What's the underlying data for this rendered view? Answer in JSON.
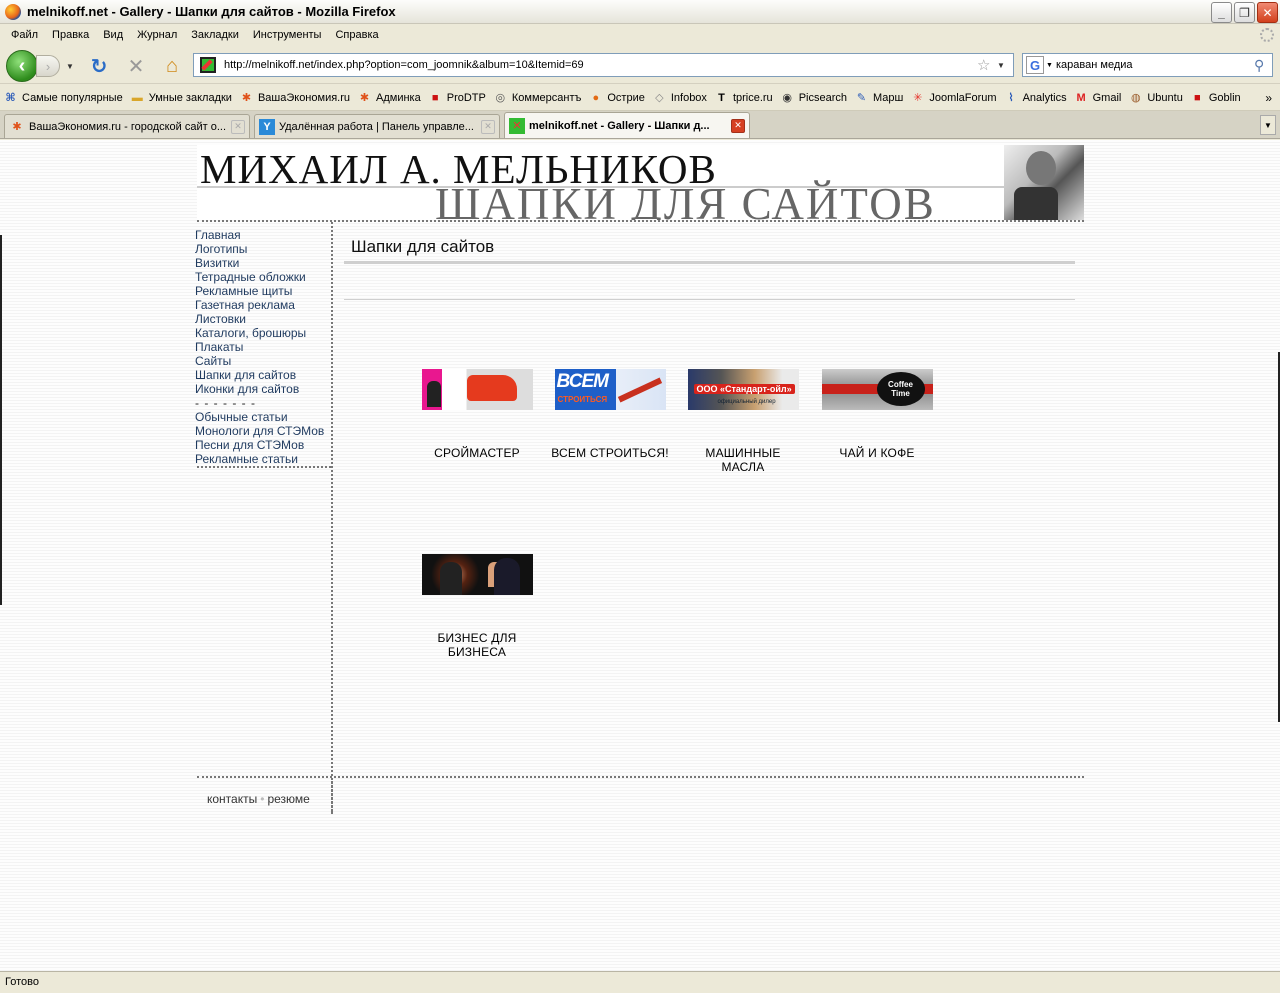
{
  "window": {
    "title": "melnikoff.net - Gallery - Шапки для сайтов - Mozilla Firefox"
  },
  "menu": [
    "Файл",
    "Правка",
    "Вид",
    "Журнал",
    "Закладки",
    "Инструменты",
    "Справка"
  ],
  "nav": {
    "url": "http://melnikoff.net/index.php?option=com_joomnik&album=10&Itemid=69",
    "search_value": "караван медиа"
  },
  "bookmarks": [
    {
      "label": "Самые популярные",
      "icon": "rss-icon"
    },
    {
      "label": "Умные закладки",
      "icon": "folder-icon"
    },
    {
      "label": "ВашаЭкономия.ru",
      "icon": "vashaekonomiya-icon"
    },
    {
      "label": "Админка",
      "icon": "vashaekonomiya-icon"
    },
    {
      "label": "ProDTP",
      "icon": "dtp-icon"
    },
    {
      "label": "Коммерсантъ",
      "icon": "kommersant-icon"
    },
    {
      "label": "Острие",
      "icon": "balloon-icon"
    },
    {
      "label": "Infobox",
      "icon": "box-icon"
    },
    {
      "label": "tprice.ru",
      "icon": "t-icon"
    },
    {
      "label": "Picsearch",
      "icon": "picsearch-icon"
    },
    {
      "label": "Марш",
      "icon": "pen-icon"
    },
    {
      "label": "JoomlaForum",
      "icon": "joomla-icon"
    },
    {
      "label": "Analytics",
      "icon": "analytics-icon"
    },
    {
      "label": "Gmail",
      "icon": "gmail-icon"
    },
    {
      "label": "Ubuntu",
      "icon": "ubuntu-icon"
    },
    {
      "label": "Goblin",
      "icon": "goblin-icon"
    }
  ],
  "tabs": [
    {
      "label": "ВашаЭкономия.ru - городской сайт о...",
      "active": false
    },
    {
      "label": "Удалённая работа | Панель управле...",
      "active": false
    },
    {
      "label": "melnikoff.net - Gallery - Шапки д...",
      "active": true
    }
  ],
  "header": {
    "name": "МИХАИЛ А. МЕЛЬНИКОВ",
    "subtitle": "ШАПКИ ДЛЯ САЙТОВ"
  },
  "sidebar": {
    "items": [
      "Главная",
      "Логотипы",
      "Визитки",
      "Тетрадные обложки",
      "Рекламные щиты",
      "Газетная реклама",
      "Листовки",
      "Каталоги, брошюры",
      "Плакаты",
      "Сайты",
      "Шапки для сайтов",
      "Иконки для сайтов"
    ],
    "separator": "- - - - - - -",
    "items2": [
      "Обычные статьи",
      "Монологи для СТЭМов",
      "Песни для СТЭМов",
      "Рекламные статьи"
    ]
  },
  "content": {
    "title": "Шапки для сайтов",
    "gallery": [
      {
        "caption": "СРОЙМАСТЕР"
      },
      {
        "caption": "ВСЕМ СТРОИТЬСЯ!",
        "thumb_text": "ВСЕМ",
        "thumb_sub": "СТРОИТЬСЯ"
      },
      {
        "caption": "МАШИННЫЕ МАСЛА",
        "thumb_text": "ООО «Стандарт-ойл»",
        "thumb_sub": "официальный дилер"
      },
      {
        "caption": "ЧАЙ И КОФЕ",
        "thumb_text": "Coffee",
        "thumb_sub": "Time"
      },
      {
        "caption": "БИЗНЕС ДЛЯ БИЗНЕСА"
      }
    ]
  },
  "footer": {
    "links": [
      "контакты",
      "резюме"
    ]
  },
  "status": {
    "text": "Готово"
  }
}
